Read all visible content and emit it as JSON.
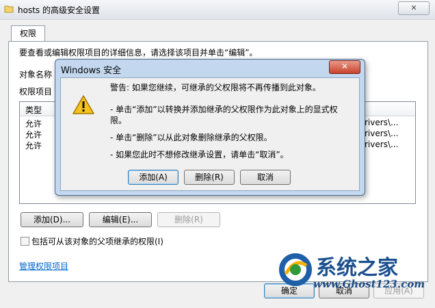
{
  "window": {
    "title": "hosts 的高级安全设置",
    "close_glyph": "✕",
    "tab_label": "权限"
  },
  "panel": {
    "intro": "要查看或编辑权限项目的详细信息，请选择该项目并单击“编辑”。",
    "object_name_label": "对象名称",
    "entries_label": "权限项目",
    "list": {
      "header_type": "类型",
      "rows": [
        {
          "type": "允许",
          "path": "rivers\\..."
        },
        {
          "type": "允许",
          "path": "rivers\\..."
        },
        {
          "type": "允许",
          "path": "rivers\\..."
        }
      ]
    },
    "buttons": {
      "add": "添加(D)...",
      "edit": "编辑(E)...",
      "remove": "删除(R)"
    },
    "inherit_checkbox_label": "包括可从该对象的父项继承的权限(I)",
    "manage_link": "管理权限项目"
  },
  "footer_buttons": {
    "ok": "确定",
    "cancel": "取消",
    "apply": "应用(A)"
  },
  "dialog": {
    "title": "Windows 安全",
    "close_glyph": "✕",
    "warning": "警告: 如果您继续，可继承的父权限将不再传播到此对象。",
    "bullet_add_1": "- 单击“添加”以转换并添加继承的父权限作为此对象上的显式权",
    "bullet_add_2": "限。",
    "bullet_remove": "- 单击“删除”以从此对象删除继承的父权限。",
    "bullet_cancel": "- 如果您此时不想修改继承设置，请单击“取消”。",
    "buttons": {
      "add": "添加(A)",
      "remove": "删除(R)",
      "cancel": "取消"
    }
  },
  "watermark": {
    "name": "系统之家",
    "url": "www.Ghost123.com"
  },
  "colors": {
    "dialog_frame": "#c3d8ee",
    "link": "#0066cc",
    "close_red": "#c8442c"
  }
}
